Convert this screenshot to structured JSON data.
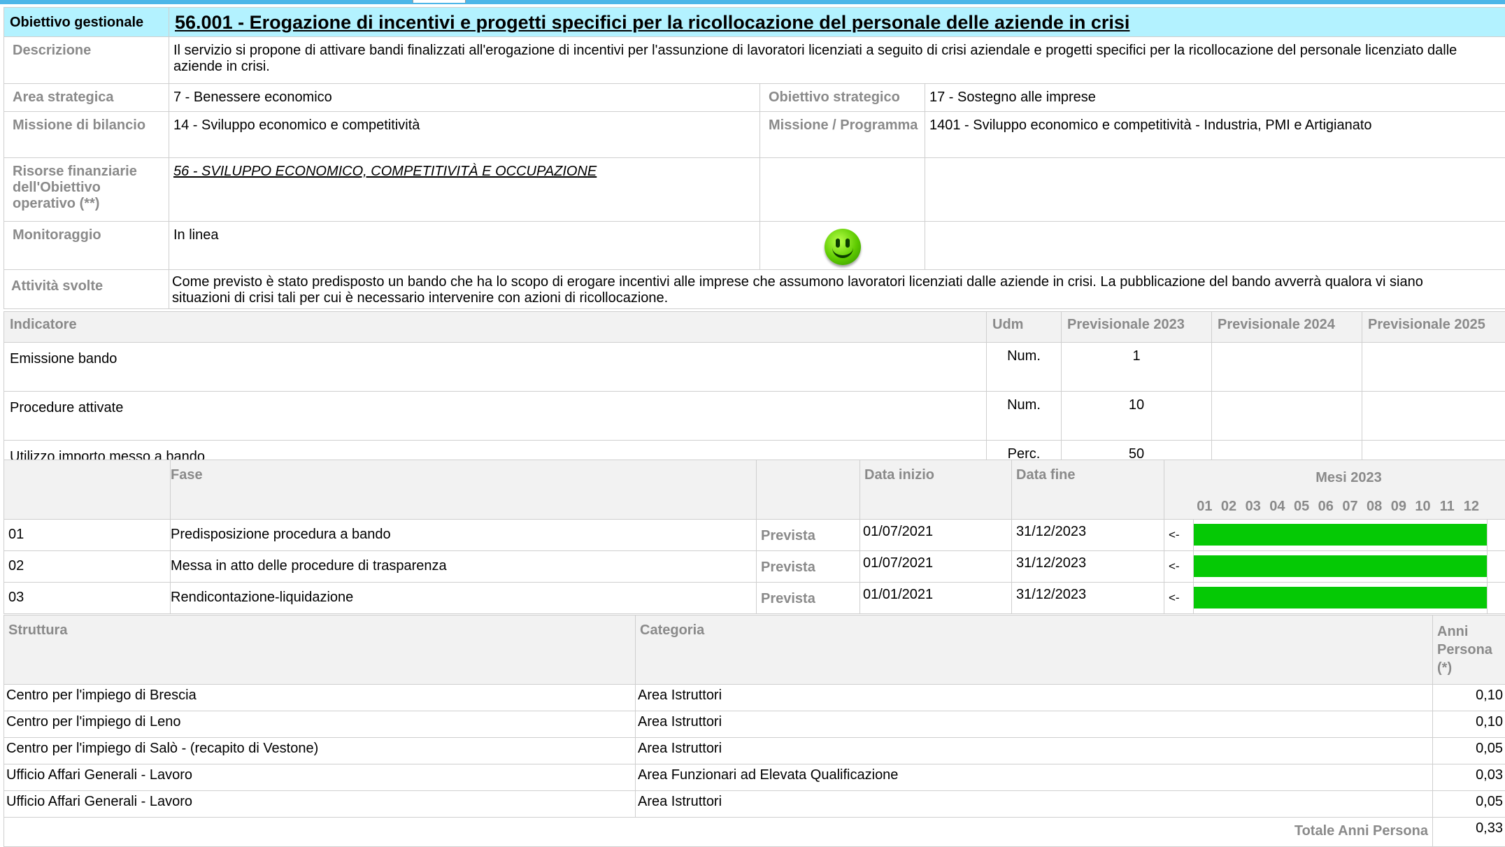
{
  "header": {
    "title_label": "Obiettivo gestionale",
    "title": "56.001 - Erogazione di incentivi e progetti specifici per la ricollocazione del personale delle aziende in crisi",
    "descrizione_label": "Descrizione",
    "descrizione": "Il servizio si propone di attivare bandi finalizzati all'erogazione di incentivi per l'assunzione di lavoratori licenziati a seguito di crisi aziendale e progetti specifici per la ricollocazione del personale licenziato dalle aziende in crisi.",
    "area_label": "Area strategica",
    "area": "7 - Benessere economico",
    "obiettivo_strategico_label": "Obiettivo strategico",
    "obiettivo_strategico": "17 - Sostegno alle imprese",
    "missione_label": "Missione di bilancio",
    "missione": "14 - Sviluppo economico e competitività",
    "programma_label": "Missione / Programma",
    "programma": "1401 - Sviluppo economico e competitività - Industria, PMI e Artigianato",
    "risorse_label": "Risorse finanziarie dell'Obiettivo operativo (**)",
    "risorse": "56 - SVILUPPO ECONOMICO, COMPETITIVITÀ E OCCUPAZIONE",
    "monitoraggio_label": "Monitoraggio",
    "monitoraggio": "In linea",
    "monitoraggio_icon": "smiley-icon",
    "attivita_label": "Attività svolte",
    "attivita": "Come previsto è stato predisposto un bando che ha lo scopo di erogare incentivi alle imprese che assumono lavoratori licenziati dalle aziende in crisi. La pubblicazione del bando avverrà qualora vi siano situazioni di crisi tali per cui è necessario intervenire con azioni di ricollocazione."
  },
  "indicatori": {
    "headers": [
      "Indicatore",
      "Udm",
      "Previsionale 2023",
      "Previsionale 2024",
      "Previsionale 2025"
    ],
    "rows": [
      {
        "nome": "Emissione bando",
        "udm": "Num.",
        "p2023": "1",
        "p2024": "",
        "p2025": ""
      },
      {
        "nome": "Procedure attivate",
        "udm": "Num.",
        "p2023": "10",
        "p2024": "",
        "p2025": ""
      },
      {
        "nome": "Utilizzo importo messo a bando",
        "udm": "Perc.",
        "p2023": "50",
        "p2024": "",
        "p2025": ""
      }
    ]
  },
  "fasi": {
    "headers": {
      "fase": "Fase",
      "data_inizio": "Data inizio",
      "data_fine": "Data fine",
      "mesi": "Mesi 2023"
    },
    "months": [
      "01",
      "02",
      "03",
      "04",
      "05",
      "06",
      "07",
      "08",
      "09",
      "10",
      "11",
      "12"
    ],
    "rows": [
      {
        "num": "01",
        "nome": "Predisposizione procedura a bando",
        "stato": "Prevista",
        "inizio": "01/07/2021",
        "fine": "31/12/2023",
        "arrow": "<-"
      },
      {
        "num": "02",
        "nome": "Messa in atto delle procedure di trasparenza",
        "stato": "Prevista",
        "inizio": "01/07/2021",
        "fine": "31/12/2023",
        "arrow": "<-"
      },
      {
        "num": "03",
        "nome": "Rendicontazione-liquidazione",
        "stato": "Prevista",
        "inizio": "01/01/2021",
        "fine": "31/12/2023",
        "arrow": "<-"
      }
    ],
    "bar_color": "#05c905"
  },
  "struttura": {
    "headers": [
      "Struttura",
      "Categoria",
      "Anni Persona (*)"
    ],
    "rows": [
      {
        "struttura": "Centro per l'impiego di Brescia",
        "categoria": "Area Istruttori",
        "anni": "0,10"
      },
      {
        "struttura": "Centro per l'impiego di Leno",
        "categoria": "Area Istruttori",
        "anni": "0,10"
      },
      {
        "struttura": "Centro per l'impiego di Salò - (recapito di Vestone)",
        "categoria": "Area Istruttori",
        "anni": "0,05"
      },
      {
        "struttura": "Ufficio Affari Generali - Lavoro",
        "categoria": "Area Funzionari ad Elevata Qualificazione",
        "anni": "0,03"
      },
      {
        "struttura": "Ufficio Affari Generali - Lavoro",
        "categoria": "Area Istruttori",
        "anni": "0,05"
      }
    ],
    "totale_label": "Totale Anni Persona",
    "totale": "0,33"
  },
  "colors": {
    "title_bg": "#b3f2ff",
    "topbar": "#4db6e8",
    "label": "#8a8a8a"
  }
}
